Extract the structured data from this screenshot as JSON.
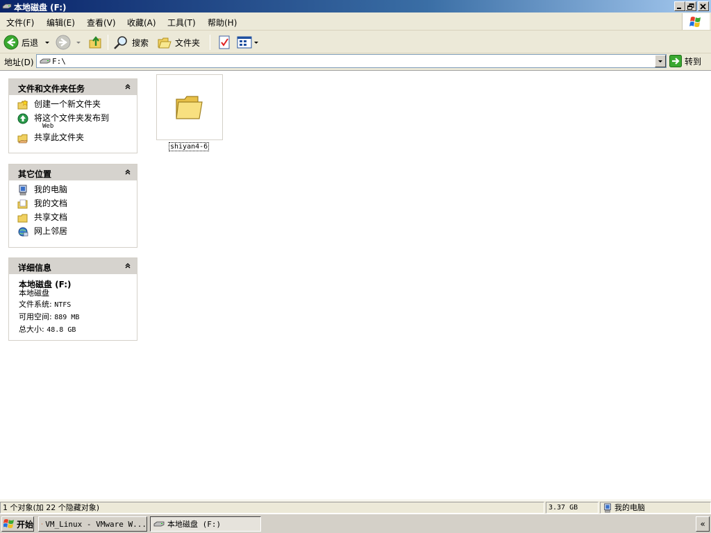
{
  "window": {
    "title": "本地磁盘 (F:)"
  },
  "menu": {
    "items": [
      {
        "label": "文件(F)"
      },
      {
        "label": "编辑(E)"
      },
      {
        "label": "查看(V)"
      },
      {
        "label": "收藏(A)"
      },
      {
        "label": "工具(T)"
      },
      {
        "label": "帮助(H)"
      }
    ]
  },
  "toolbar": {
    "back_label": "后退",
    "search_label": "搜索",
    "folders_label": "文件夹"
  },
  "address": {
    "label": "地址(D)",
    "value": "F:\\",
    "go_label": "转到"
  },
  "panes": {
    "file_tasks": {
      "title": "文件和文件夹任务",
      "items": [
        {
          "label": "创建一个新文件夹",
          "icon": "new-folder-icon"
        },
        {
          "label": "将这个文件夹发布到",
          "sub": "Web",
          "icon": "publish-web-icon"
        },
        {
          "label": "共享此文件夹",
          "icon": "share-folder-icon"
        }
      ]
    },
    "other_places": {
      "title": "其它位置",
      "items": [
        {
          "label": "我的电脑",
          "icon": "my-computer-icon"
        },
        {
          "label": "我的文档",
          "icon": "my-documents-icon"
        },
        {
          "label": "共享文档",
          "icon": "shared-documents-icon"
        },
        {
          "label": "网上邻居",
          "icon": "network-places-icon"
        }
      ]
    },
    "details": {
      "title": "详细信息",
      "name": "本地磁盘 (F:)",
      "type": "本地磁盘",
      "fs_label": "文件系统:",
      "fs_value": "NTFS",
      "free_label": "可用空间:",
      "free_value": "889 MB",
      "total_label": "总大小:",
      "total_value": "48.8 GB"
    }
  },
  "files": [
    {
      "name": "shiyan4-6",
      "icon": "folder-icon"
    }
  ],
  "status": {
    "objects": "1 个对象(加 22 个隐藏对象)",
    "size": "3.37 GB",
    "zone": "我的电脑"
  },
  "taskbar": {
    "start_label": "开始",
    "buttons": [
      {
        "label": "VM_Linux - VMware W..."
      },
      {
        "label": "本地磁盘 (F:)"
      }
    ],
    "tray_label": "«"
  },
  "colors": {
    "title_gradient_start": "#0a246a",
    "title_gradient_end": "#a6caf0",
    "pane_header": "#d6d3ce",
    "chrome": "#ece9d8"
  }
}
